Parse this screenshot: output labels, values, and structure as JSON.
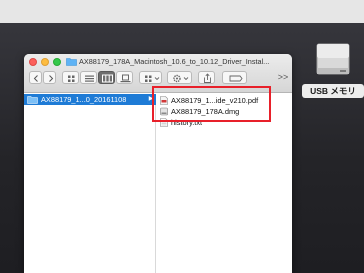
{
  "window": {
    "title": "AX88179_178A_Macintosh_10.6_to_10.12_Driver_Instal..."
  },
  "toolbar": {
    "back": "<",
    "forward": ">",
    "more": ">>"
  },
  "sidebar_column": {
    "selected_folder": "AX88179_1...0_20161108",
    "disclosure": "▶"
  },
  "files": [
    {
      "name": "AX88179_1...ide_v210.pdf",
      "icon": "pdf-file-icon"
    },
    {
      "name": "AX88179_178A.dmg",
      "icon": "disk-image-icon"
    },
    {
      "name": "history.txt",
      "icon": "text-file-icon"
    }
  ],
  "desktop": {
    "drive_label": "USB メモリ"
  },
  "colors": {
    "selection": "#1e7bd6",
    "highlight_box": "#e8202a"
  }
}
